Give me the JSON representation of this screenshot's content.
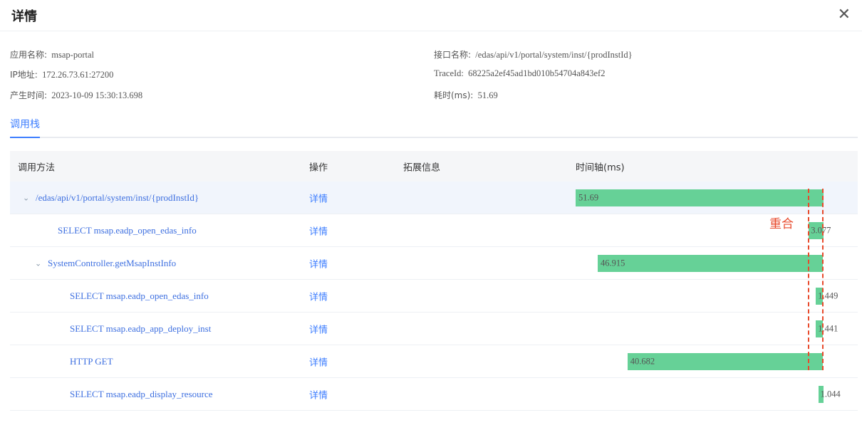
{
  "dialog": {
    "title": "详情",
    "close_icon": "close-icon"
  },
  "info": {
    "app_label": "应用名称:",
    "app_value": "msap-portal",
    "ip_label": "IP地址:",
    "ip_value": "172.26.73.61:27200",
    "time_label": "产生时间:",
    "time_value": "2023-10-09 15:30:13.698",
    "api_label": "接口名称:",
    "api_value": "/edas/api/v1/portal/system/inst/{prodInstId}",
    "trace_label": "TraceId:",
    "trace_value": "68225a2ef45ad1bd010b54704a843ef2",
    "cost_label": "耗时(ms):",
    "cost_value": "51.69"
  },
  "tabs": [
    {
      "label": "调用栈"
    }
  ],
  "table": {
    "headers": [
      "调用方法",
      "操作",
      "拓展信息",
      "时间轴(ms)"
    ],
    "total_ms": 51.69,
    "bar_color": "#66d197",
    "rows": [
      {
        "method": "/edas/api/v1/portal/system/inst/{prodInstId}",
        "depth": 0,
        "expand": true,
        "action": "详情",
        "start_ms": 0,
        "duration": "51.69"
      },
      {
        "method": "SELECT msap.eadp_open_edas_info",
        "depth": 1,
        "expand": false,
        "action": "详情",
        "start_ms": 48.6,
        "duration": "3.077"
      },
      {
        "method": "SystemController.getMsapInstInfo",
        "depth": 1,
        "expand": true,
        "action": "详情",
        "start_ms": 4.6,
        "duration": "46.915"
      },
      {
        "method": "SELECT msap.eadp_open_edas_info",
        "depth": 2,
        "expand": false,
        "action": "详情",
        "start_ms": 50.1,
        "duration": "1.449"
      },
      {
        "method": "SELECT msap.eadp_app_deploy_inst",
        "depth": 2,
        "expand": false,
        "action": "详情",
        "start_ms": 50.1,
        "duration": "1.441"
      },
      {
        "method": "HTTP GET",
        "depth": 2,
        "expand": false,
        "action": "详情",
        "start_ms": 10.8,
        "duration": "40.682"
      },
      {
        "method": "SELECT msap.eadp_display_resource",
        "depth": 2,
        "expand": false,
        "action": "详情",
        "start_ms": 50.6,
        "duration": "1.044"
      }
    ]
  },
  "annotation": {
    "label": "重合",
    "color": "#e84a2c"
  }
}
